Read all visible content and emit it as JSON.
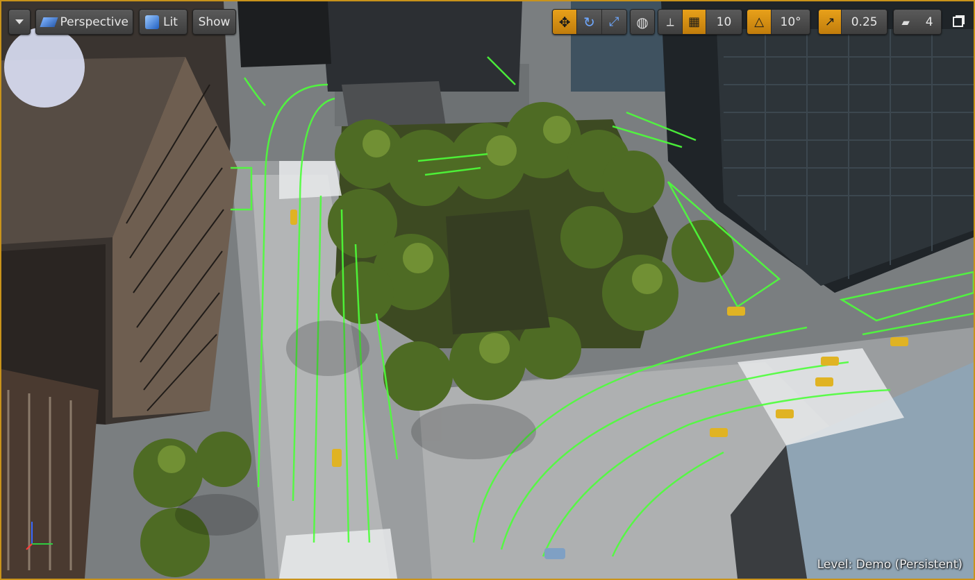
{
  "toolbar": {
    "menu_icon": "chevron-down-icon",
    "perspective_label": "Perspective",
    "lit_label": "Lit",
    "show_label": "Show",
    "grid_snap_value": "10",
    "rotation_snap_value": "10°",
    "scale_snap_value": "0.25",
    "camera_speed_value": "4"
  },
  "status": {
    "level_label": "Level:",
    "level_name": "Demo (Persistent)"
  },
  "colors": {
    "viewport_border": "#c9931a",
    "accent": "#e8a11a",
    "spline_green": "#4dff3a"
  }
}
